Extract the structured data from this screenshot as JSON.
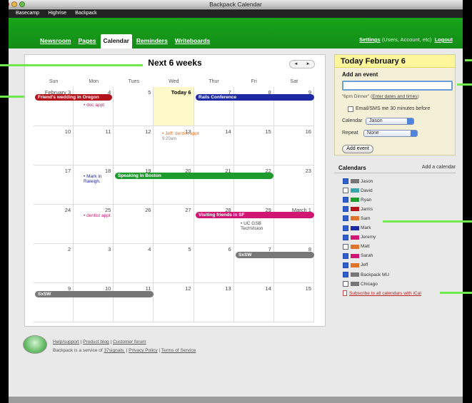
{
  "window": {
    "title": "Backpack Calendar"
  },
  "topnav": [
    "Basecamp",
    "Highrise",
    "Backpack"
  ],
  "tabs": [
    "Newsroom",
    "Pages",
    "Calendar",
    "Reminders",
    "Writeboards"
  ],
  "active_tab": "Calendar",
  "account": {
    "settings": "Settings",
    "settings_note": "(Users, Account, etc)",
    "logout": "Logout"
  },
  "calendar": {
    "heading": "Next 6 weeks",
    "nav_prev": "◄",
    "nav_next": "►",
    "days": [
      "Sun",
      "Mon",
      "Tues",
      "Wed",
      "Thur",
      "Fri",
      "Sat"
    ],
    "weeks": [
      [
        "February 3",
        "4",
        "5",
        "Today 6",
        "7",
        "8",
        "9"
      ],
      [
        "10",
        "11",
        "12",
        "13",
        "14",
        "15",
        "16"
      ],
      [
        "17",
        "18",
        "19",
        "20",
        "21",
        "22",
        "23"
      ],
      [
        "24",
        "25",
        "26",
        "27",
        "28",
        "29",
        "March 1"
      ],
      [
        "2",
        "3",
        "4",
        "5",
        "6",
        "7",
        "8"
      ],
      [
        "9",
        "10",
        "11",
        "12",
        "13",
        "14",
        "15"
      ]
    ],
    "events": {
      "wedding": "Friend's wedding in Oregon",
      "doc": "• doc appt",
      "rails": "Rails Conference",
      "jeff": "• Jeff: dentist appt",
      "jeff_time": "9:20am",
      "mark": "• Mark in Raleigh.",
      "boston": "Speaking in Boston",
      "dentist": "• dentist appt",
      "sf": "Visiting friends in SF",
      "uc": "• UC GSB TechVision",
      "sxsw": "SxSW"
    }
  },
  "sidebar": {
    "today": "Today February 6",
    "add_event": "Add an event",
    "input_value": "",
    "hint_text": "\"6pm Dinner\"",
    "hint_link": "Enter dates and times",
    "email_sms": "Email/SMS me 30 minutes before",
    "calendar_label": "Calendar",
    "calendar_value": "Jason",
    "repeat_label": "Repeat",
    "repeat_value": "None",
    "add_button": "Add event",
    "calendars_title": "Calendars",
    "add_calendar": "Add a calendar",
    "calendars": [
      {
        "name": "Jason",
        "checked": true,
        "color": "#777777"
      },
      {
        "name": "David",
        "checked": false,
        "color": "#3aa6a8"
      },
      {
        "name": "Ryan",
        "checked": true,
        "color": "#1d9b2e"
      },
      {
        "name": "Jamis",
        "checked": true,
        "color": "#b3121b"
      },
      {
        "name": "Sam",
        "checked": true,
        "color": "#e0742c"
      },
      {
        "name": "Mark",
        "checked": true,
        "color": "#1d2aa3"
      },
      {
        "name": "Jeremy",
        "checked": true,
        "color": "#cf1672"
      },
      {
        "name": "Matt",
        "checked": false,
        "color": "#e0742c"
      },
      {
        "name": "Sarah",
        "checked": true,
        "color": "#cf1672"
      },
      {
        "name": "Jeff",
        "checked": true,
        "color": "#e0742c"
      },
      {
        "name": "Backpack MU",
        "checked": true,
        "color": "#777777"
      },
      {
        "name": "Chicago",
        "checked": false,
        "color": "#777777"
      }
    ],
    "ical": "Subscribe to all calendars with iCal"
  },
  "footer": {
    "line1": [
      "Help/support",
      "Product blog",
      "Customer forum"
    ],
    "line2_prefix": "Backpack is a service of",
    "company": "37signals.",
    "privacy": "Privacy Policy",
    "terms": "Terms of Service"
  }
}
